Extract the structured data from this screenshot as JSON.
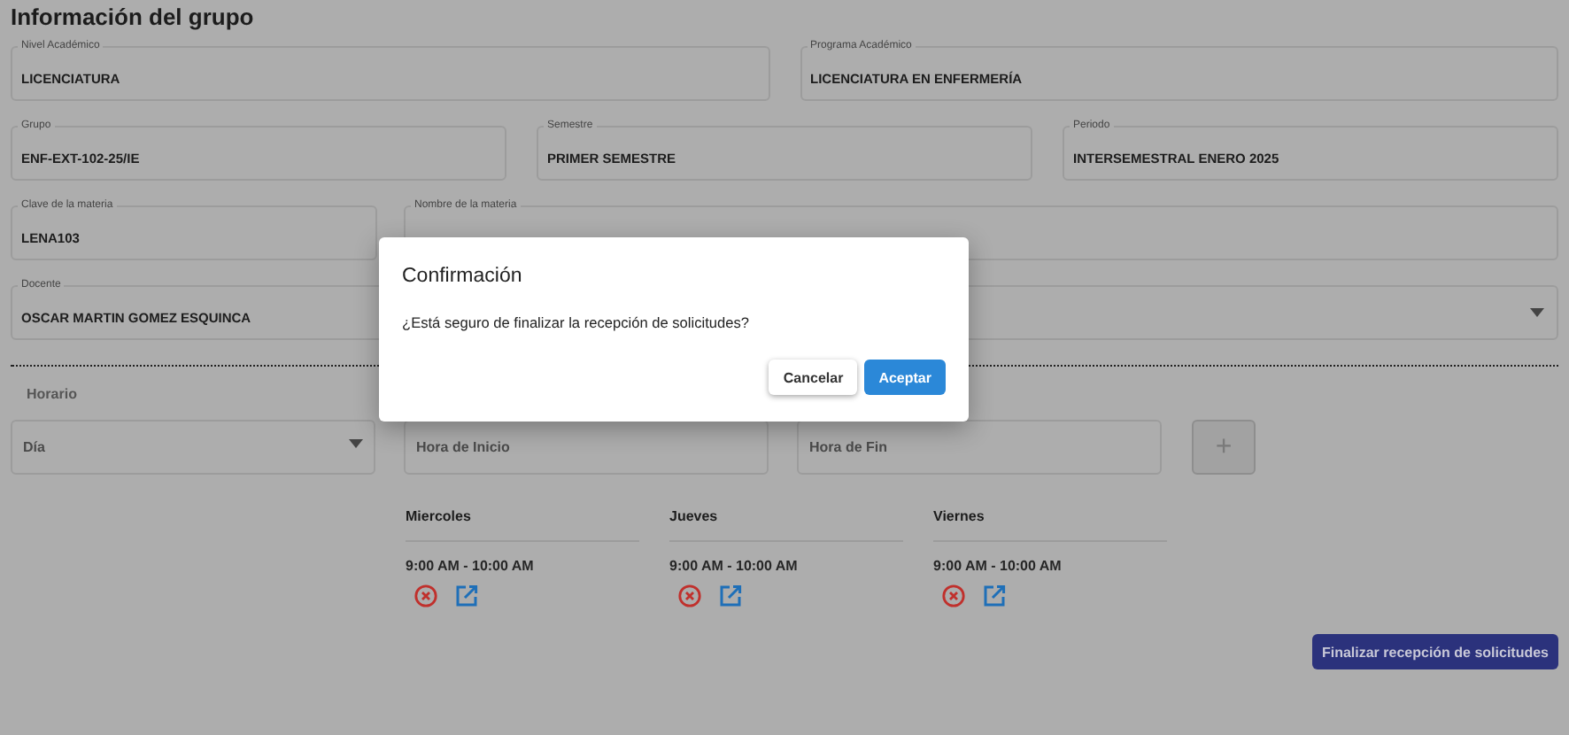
{
  "title": "Información del grupo",
  "field_rows": [
    [
      {
        "label": "Nivel Académico",
        "value": "LICENCIATURA",
        "kind": "text"
      },
      {
        "label": "Programa Académico",
        "value": "LICENCIATURA EN ENFERMERÍA",
        "kind": "text"
      }
    ],
    [
      {
        "label": "Grupo",
        "value": "ENF-EXT-102-25/IE",
        "kind": "text"
      },
      {
        "label": "Semestre",
        "value": "PRIMER SEMESTRE",
        "kind": "text"
      },
      {
        "label": "Periodo",
        "value": "INTERSEMESTRAL ENERO 2025",
        "kind": "text"
      }
    ],
    [
      {
        "label": "Clave de la materia",
        "value": "LENA103",
        "kind": "text"
      },
      {
        "label": "Nombre de la materia",
        "kind": "text"
      }
    ],
    [
      {
        "label": "Docente",
        "value": "OSCAR MARTIN GOMEZ ESQUINCA",
        "kind": "text"
      },
      {
        "kind": "select"
      }
    ]
  ],
  "schedule": {
    "heading": "Horario",
    "day": {
      "placeholder": "Día"
    },
    "start": {
      "placeholder": "Hora de Inicio"
    },
    "end": {
      "placeholder": "Hora de Fin"
    },
    "add_button": "+",
    "days": [
      {
        "name": "Miercoles",
        "slots": [
          "9:00 AM - 10:00 AM"
        ]
      },
      {
        "name": "Jueves",
        "slots": [
          "9:00 AM - 10:00 AM"
        ]
      },
      {
        "name": "Viernes",
        "slots": [
          "9:00 AM - 10:00 AM"
        ]
      }
    ]
  },
  "finish_button": "Finalizar recepción de solicitudes",
  "dialog": {
    "title": "Confirmación",
    "message": "¿Está seguro de finalizar la recepción de solicitudes?",
    "buttons": [
      {
        "label": "Cancelar",
        "kind": "secondary"
      },
      {
        "label": "Aceptar",
        "kind": "primary"
      }
    ]
  }
}
